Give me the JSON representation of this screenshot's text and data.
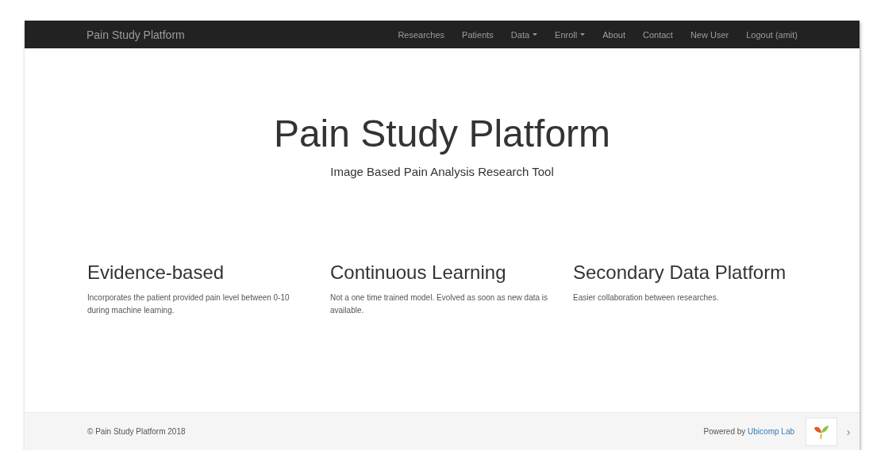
{
  "navbar": {
    "brand": "Pain Study Platform",
    "items": [
      {
        "label": "Researches",
        "dropdown": false
      },
      {
        "label": "Patients",
        "dropdown": false
      },
      {
        "label": "Data",
        "dropdown": true
      },
      {
        "label": "Enroll",
        "dropdown": true
      },
      {
        "label": "About",
        "dropdown": false
      },
      {
        "label": "Contact",
        "dropdown": false
      },
      {
        "label": "New User",
        "dropdown": false
      },
      {
        "label": "Logout (amit)",
        "dropdown": false
      }
    ]
  },
  "hero": {
    "title": "Pain Study Platform",
    "subtitle": "Image Based Pain Analysis Research Tool"
  },
  "features": [
    {
      "heading": "Evidence-based",
      "text": "Incorporates the patient provided pain level between 0-10 during machine learning."
    },
    {
      "heading": "Continuous Learning",
      "text": "Not a one time trained model. Evolved as soon as new data is available."
    },
    {
      "heading": "Secondary Data Platform",
      "text": "Easier collaboration between researches."
    }
  ],
  "footer": {
    "copyright": "© Pain Study Platform 2018",
    "powered_by": "Powered by",
    "link": "Ubicomp Lab",
    "side_tab": "›"
  }
}
